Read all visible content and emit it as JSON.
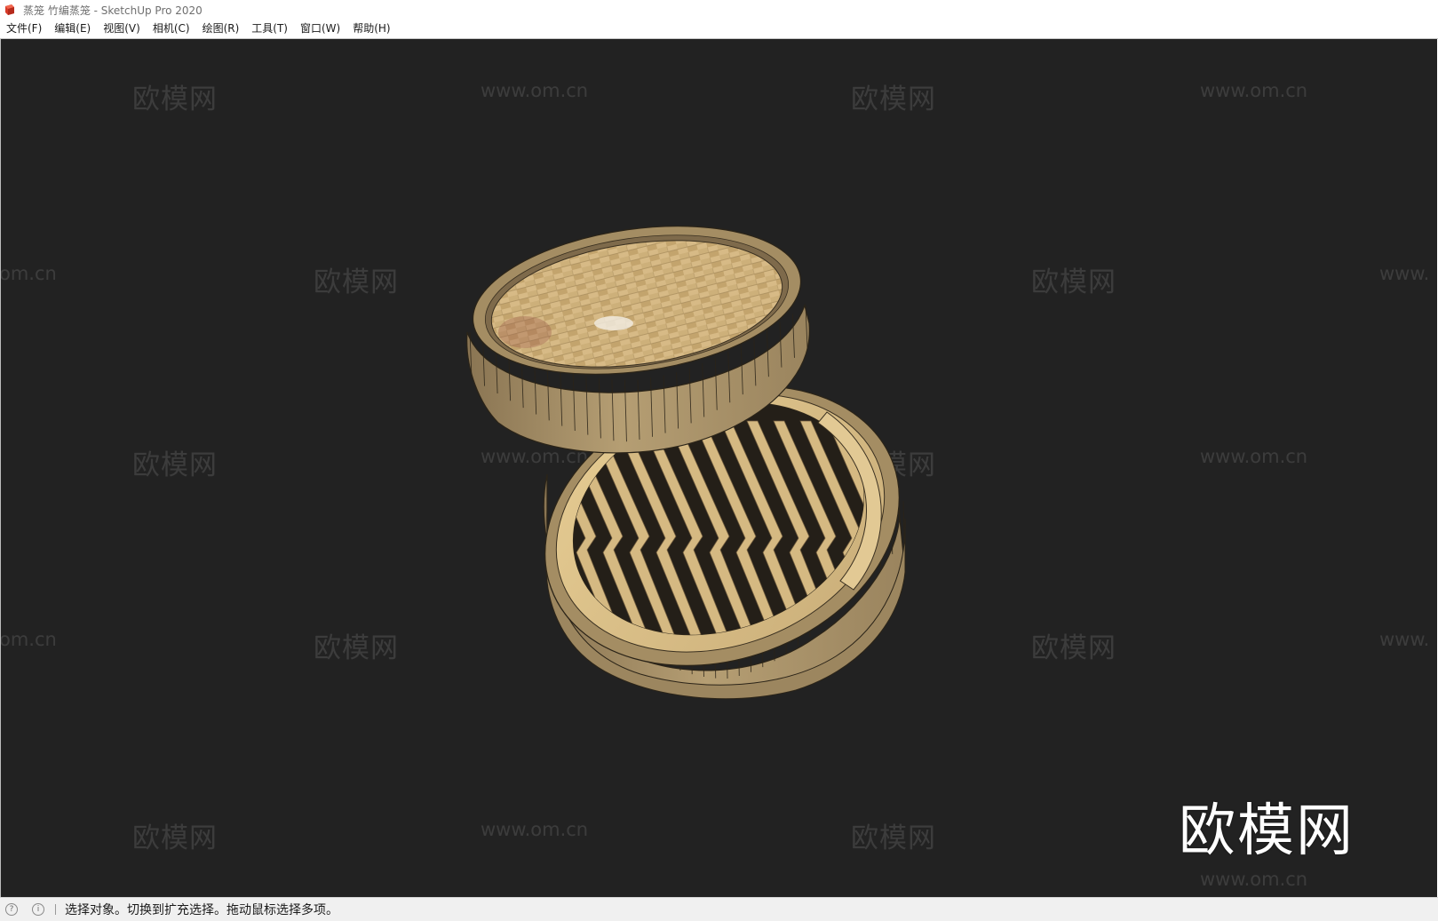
{
  "window": {
    "title": "蒸笼 竹编蒸笼 - SketchUp Pro 2020",
    "app_icon": "sketchup-logo-icon"
  },
  "menu": {
    "items": [
      {
        "label": "文件(F)"
      },
      {
        "label": "编辑(E)"
      },
      {
        "label": "视图(V)"
      },
      {
        "label": "相机(C)"
      },
      {
        "label": "绘图(R)"
      },
      {
        "label": "工具(T)"
      },
      {
        "label": "窗口(W)"
      },
      {
        "label": "帮助(H)"
      }
    ]
  },
  "viewport": {
    "background_color": "#222222",
    "model": "bamboo-steamer",
    "watermark_brand": "欧模网",
    "watermark_url": "www.om.cn",
    "watermark_url_partial_left": "om.cn",
    "watermark_url_partial_right": "www.",
    "watermark_big": "欧模网"
  },
  "status": {
    "icon1": "geo-location-icon",
    "icon2": "info-icon",
    "message": "选择对象。切换到扩充选择。拖动鼠标选择多项。"
  },
  "colors": {
    "bamboo_light": "#d9bf8c",
    "bamboo_mid": "#b9a173",
    "bamboo_dark": "#8c7652",
    "edge_line": "#2b2418"
  }
}
